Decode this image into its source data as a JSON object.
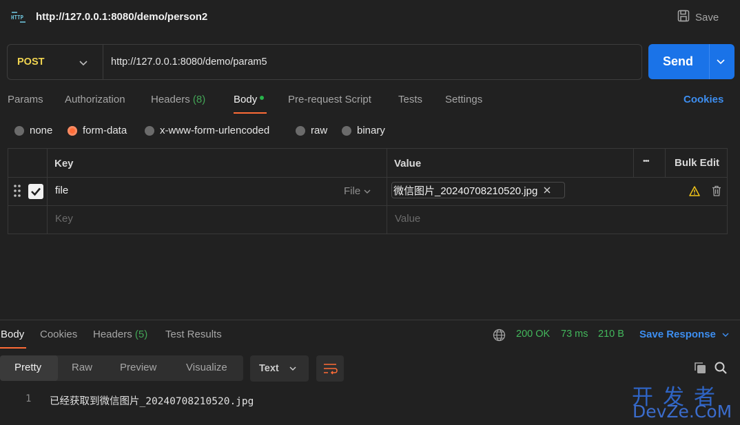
{
  "header": {
    "title": "http://127.0.0.1:8080/demo/person2",
    "save_label": "Save",
    "icon": "http-icon"
  },
  "request": {
    "method": "POST",
    "url": "http://127.0.0.1:8080/demo/param5",
    "send_label": "Send"
  },
  "request_tabs": {
    "params": "Params",
    "authorization": "Authorization",
    "headers": "Headers",
    "headers_count": "(8)",
    "body": "Body",
    "prerequest": "Pre-request Script",
    "tests": "Tests",
    "settings": "Settings",
    "cookies": "Cookies"
  },
  "body_types": {
    "none": "none",
    "form_data": "form-data",
    "urlencoded": "x-www-form-urlencoded",
    "raw": "raw",
    "binary": "binary",
    "selected": "form-data"
  },
  "kv_table": {
    "key_header": "Key",
    "value_header": "Value",
    "more": "•••",
    "bulk_edit": "Bulk Edit",
    "rows": [
      {
        "key": "file",
        "type": "File",
        "value": "微信图片_20240708210520.jpg",
        "checked": true
      }
    ],
    "key_placeholder": "Key",
    "value_placeholder": "Value"
  },
  "response": {
    "tabs": {
      "body": "Body",
      "cookies": "Cookies",
      "headers": "Headers",
      "headers_count": "(5)",
      "test_results": "Test Results"
    },
    "status": "200 OK",
    "time": "73 ms",
    "size": "210 B",
    "save_response": "Save Response",
    "views": {
      "pretty": "Pretty",
      "raw": "Raw",
      "preview": "Preview",
      "visualize": "Visualize"
    },
    "format": "Text",
    "lines": [
      {
        "no": "1",
        "text": "已经获取到微信图片_20240708210520.jpg"
      }
    ]
  },
  "watermark": {
    "cn": "开发者",
    "en": "DevZe.CoM"
  },
  "colors": {
    "accent": "#ff6c37",
    "primary": "#1a73e8",
    "success": "#43b85c",
    "method": "#f0d450",
    "link": "#3d8ef0"
  }
}
